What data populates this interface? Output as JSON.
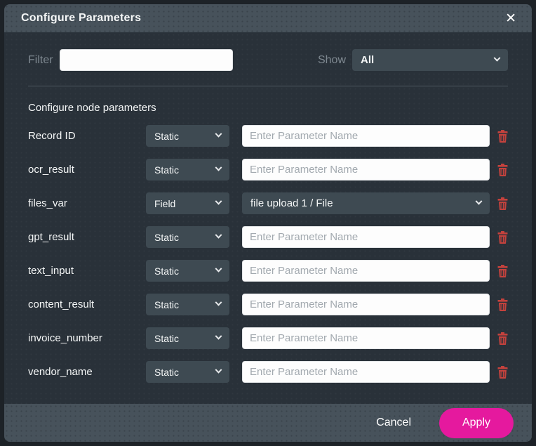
{
  "modal": {
    "title": "Configure Parameters",
    "close_icon": "✕"
  },
  "filter": {
    "label": "Filter",
    "value": "",
    "placeholder": ""
  },
  "show": {
    "label": "Show",
    "selected": "All"
  },
  "section_heading": "Configure node parameters",
  "rows": [
    {
      "name": "Record ID",
      "type": "Static",
      "kind": "input",
      "placeholder": "Enter Parameter Name",
      "value": ""
    },
    {
      "name": "ocr_result",
      "type": "Static",
      "kind": "input",
      "placeholder": "Enter Parameter Name",
      "value": ""
    },
    {
      "name": "files_var",
      "type": "Field",
      "kind": "select",
      "value": "file upload 1 / File"
    },
    {
      "name": "gpt_result",
      "type": "Static",
      "kind": "input",
      "placeholder": "Enter Parameter Name",
      "value": ""
    },
    {
      "name": "text_input",
      "type": "Static",
      "kind": "input",
      "placeholder": "Enter Parameter Name",
      "value": ""
    },
    {
      "name": "content_result",
      "type": "Static",
      "kind": "input",
      "placeholder": "Enter Parameter Name",
      "value": ""
    },
    {
      "name": "invoice_number",
      "type": "Static",
      "kind": "input",
      "placeholder": "Enter Parameter Name",
      "value": ""
    },
    {
      "name": "vendor_name",
      "type": "Static",
      "kind": "input",
      "placeholder": "Enter Parameter Name",
      "value": ""
    }
  ],
  "footer": {
    "cancel_label": "Cancel",
    "apply_label": "Apply"
  },
  "colors": {
    "accent_pink": "#e5199e",
    "trash_red": "#c4423d",
    "header_bg": "#47525b",
    "body_bg": "#293139",
    "select_bg": "#3e4a52",
    "overlay_bg": "#1d2227"
  }
}
